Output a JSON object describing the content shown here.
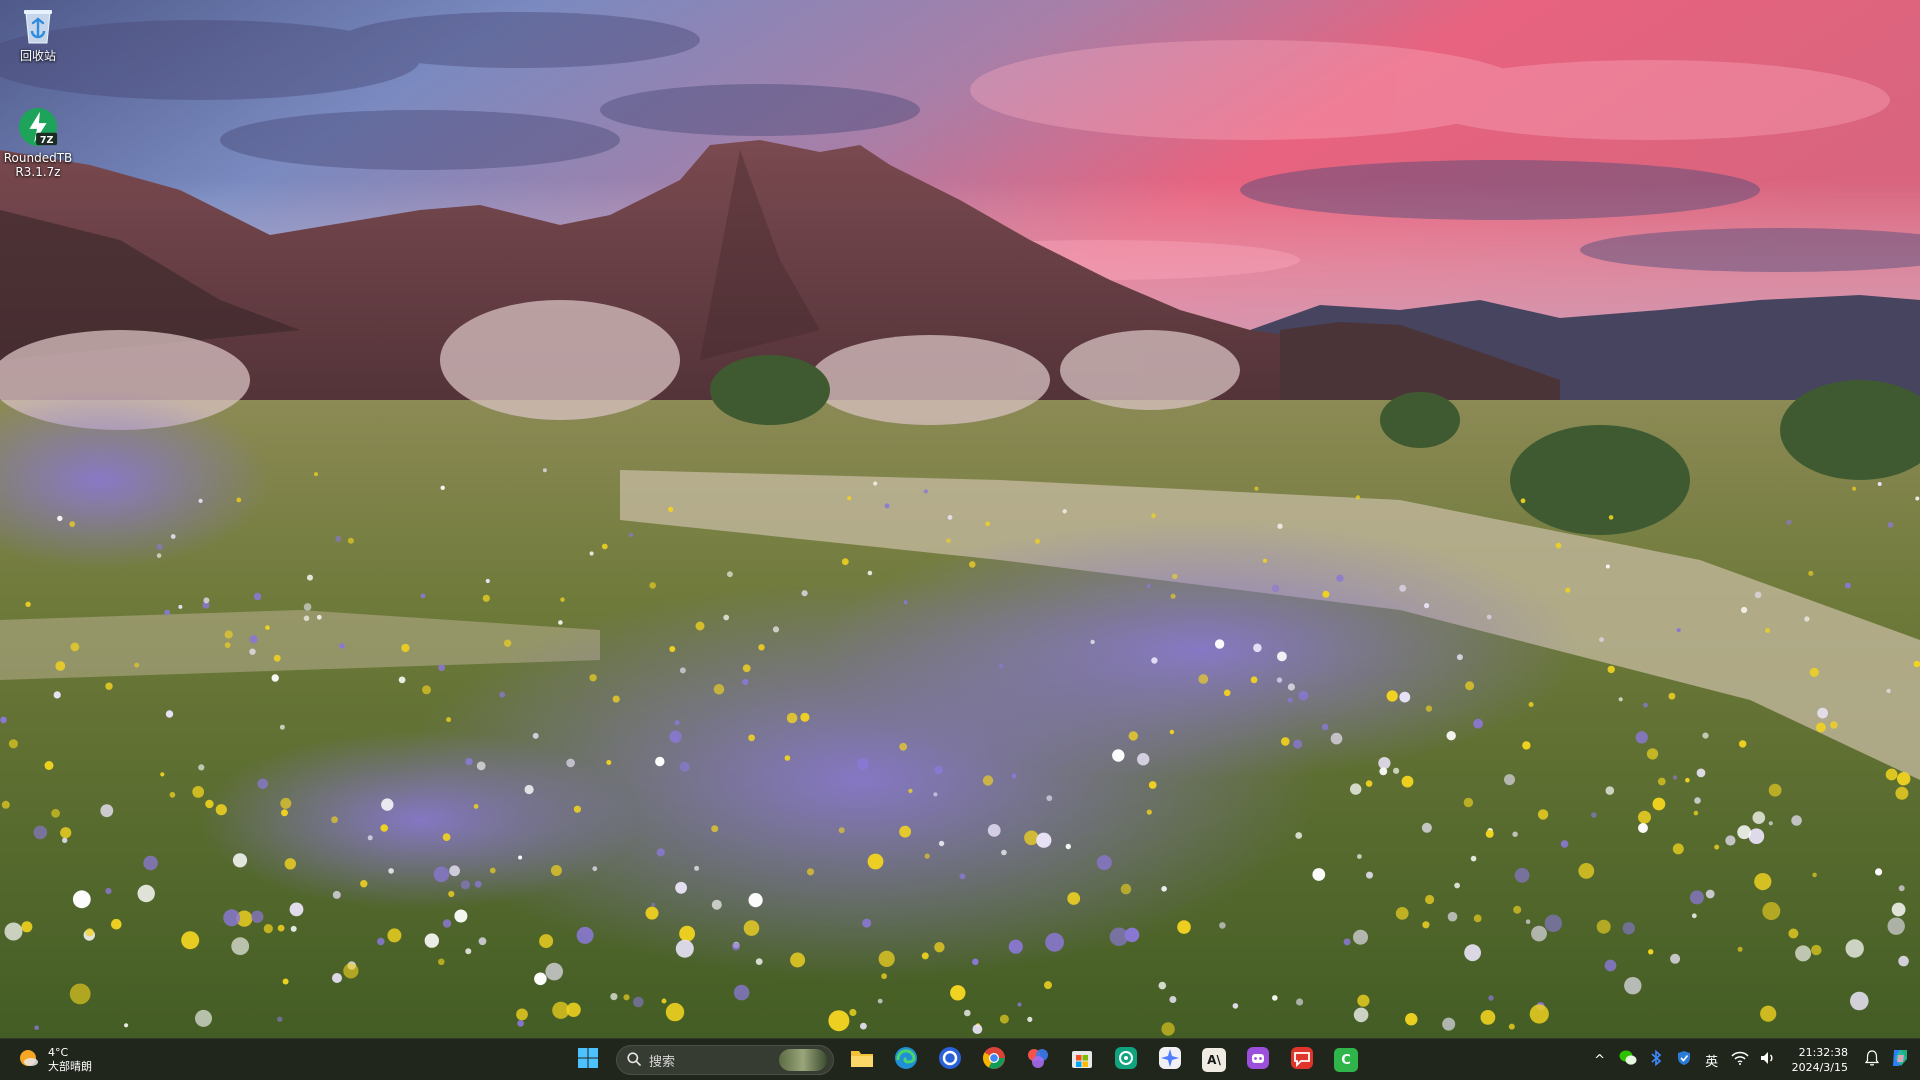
{
  "desktop": {
    "icons": [
      {
        "id": "recycle",
        "label": "回收站",
        "icon": "recycle-bin-icon"
      },
      {
        "id": "roundedtb",
        "label": "RoundedTB\nR3.1.7z",
        "icon": "7zip-archive-icon",
        "badge": "7Z"
      }
    ]
  },
  "taskbar": {
    "weather": {
      "temp": "4°C",
      "condition": "大部晴朗",
      "icon": "weather-sun-icon"
    },
    "search": {
      "placeholder": "搜索",
      "icon": "search-icon"
    },
    "apps": [
      {
        "name": "start",
        "icon": "windows-start-icon"
      },
      {
        "name": "file-explorer",
        "icon": "folder-icon"
      },
      {
        "name": "edge",
        "icon": "edge-browser-icon"
      },
      {
        "name": "circle-app",
        "icon": "blue-circle-app-icon"
      },
      {
        "name": "chrome",
        "icon": "chrome-icon"
      },
      {
        "name": "photos",
        "icon": "photos-icon"
      },
      {
        "name": "microsoft-store",
        "icon": "store-icon"
      },
      {
        "name": "chatgpt",
        "icon": "chatgpt-icon"
      },
      {
        "name": "sparkle-app",
        "icon": "sparkle-icon"
      },
      {
        "name": "anthropic",
        "icon": "anthropic-icon",
        "glyph": "A\\"
      },
      {
        "name": "chat-bot",
        "icon": "chat-bot-icon"
      },
      {
        "name": "message-app",
        "icon": "message-icon"
      },
      {
        "name": "camtasia",
        "icon": "camtasia-icon",
        "glyph": "C"
      }
    ],
    "tray": {
      "items": [
        {
          "name": "overflow",
          "icon": "chevron-up-icon",
          "glyph": "^"
        },
        {
          "name": "wechat",
          "icon": "wechat-icon"
        },
        {
          "name": "bluetooth",
          "icon": "bluetooth-icon"
        },
        {
          "name": "defender",
          "icon": "shield-icon"
        },
        {
          "name": "ime",
          "icon": "ime-icon",
          "glyph": "英"
        },
        {
          "name": "wifi",
          "icon": "wifi-icon"
        },
        {
          "name": "volume",
          "icon": "speaker-icon"
        }
      ],
      "time": "21:32:38",
      "date": "2024/3/15",
      "notification_icon": "bell-icon",
      "copilot_icon": "copilot-icon"
    }
  },
  "colors": {
    "taskbar_bg": "#1e221c",
    "sky_pink": "#e8607e",
    "sky_blue": "#7f8fc0",
    "mountain": "#6e4044",
    "flower_purple": "#8a78d4",
    "flower_yellow": "#f2d320"
  }
}
